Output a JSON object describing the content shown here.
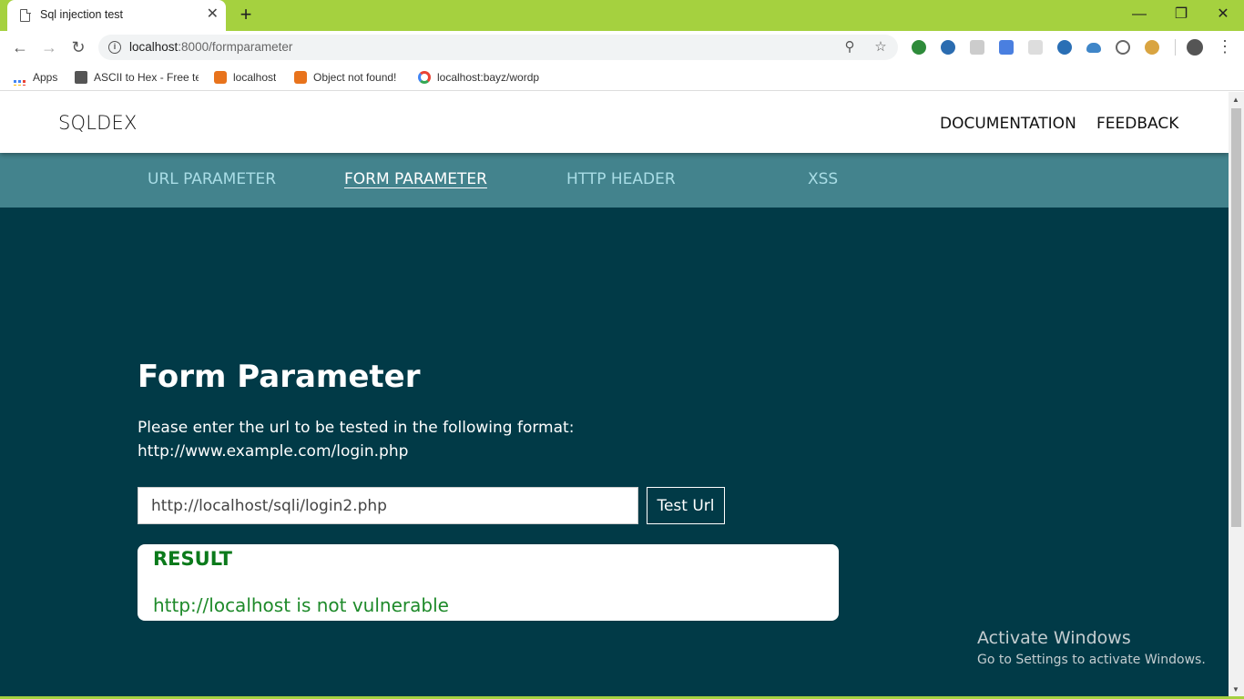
{
  "browser": {
    "tab_title": "Sql injection test",
    "new_tab_label": "+",
    "url_host": "localhost",
    "url_path": ":8000/formparameter",
    "window_controls": {
      "minimize": "—",
      "restore": "❐",
      "close": "✕"
    },
    "icons": [
      "back-icon",
      "forward-icon",
      "reload-icon",
      "info-icon",
      "zoom-icon",
      "star-icon",
      "profile-icon",
      "menu-icon"
    ]
  },
  "bookmarks": [
    {
      "label": "Apps",
      "icon": "apps-grid-icon"
    },
    {
      "label": "ASCII to Hex - Free te",
      "icon": "ascii-icon"
    },
    {
      "label": "localhost",
      "icon": "xampp-icon"
    },
    {
      "label": "Object not found!",
      "icon": "xampp-icon"
    },
    {
      "label": "localhost:bayz/wordp",
      "icon": "google-icon"
    }
  ],
  "site": {
    "brand": "SQLDEX",
    "header_links": [
      "DOCUMENTATION",
      "FEEDBACK"
    ],
    "subnav": [
      {
        "label": "URL PARAMETER",
        "active": false
      },
      {
        "label": "FORM PARAMETER",
        "active": true
      },
      {
        "label": "HTTP HEADER",
        "active": false
      },
      {
        "label": "XSS",
        "active": false
      }
    ]
  },
  "main": {
    "title": "Form Parameter",
    "description_line1": "Please enter the url to be tested in the following format:",
    "description_line2": "http://www.example.com/login.php",
    "url_value": "http://localhost/sqli/login2.php",
    "button_label": "Test Url",
    "result_label": "RESULT",
    "result_text": "http://localhost is not vulnerable"
  },
  "watermark": {
    "title": "Activate Windows",
    "subtitle": "Go to Settings to activate Windows."
  },
  "colors": {
    "chrome_accent": "#a5d13f",
    "page_background": "#013a47",
    "subnav_background": "#43838d",
    "result_green": "#0b7a1b"
  }
}
